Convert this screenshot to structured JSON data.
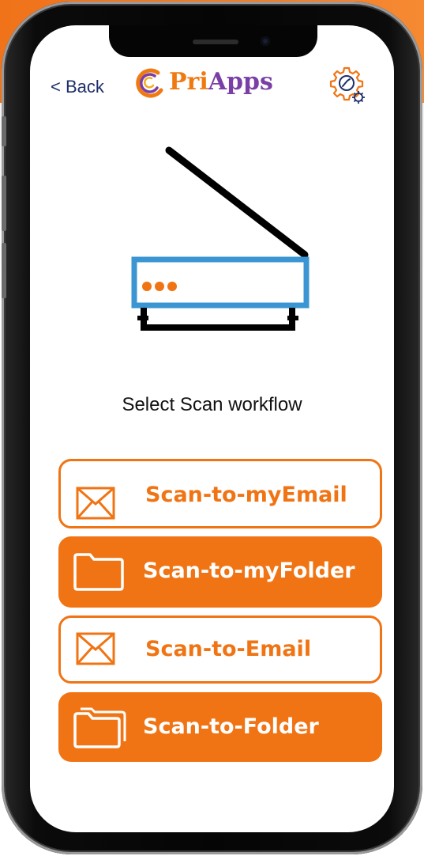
{
  "header": {
    "back_label": "< Back",
    "logo": {
      "part1": "Pri",
      "part2": "Apps"
    },
    "settings_icon": "settings-gear-icon"
  },
  "main": {
    "illustration": "scanner-icon",
    "title": "Select Scan workflow",
    "workflows": [
      {
        "label": "Scan-to-myEmail",
        "icon": "envelope-icon",
        "style": "outline"
      },
      {
        "label": "Scan-to-myFolder",
        "icon": "folder-icon",
        "style": "filled"
      },
      {
        "label": "Scan-to-Email",
        "icon": "envelope-icon",
        "style": "outline"
      },
      {
        "label": "Scan-to-Folder",
        "icon": "folders-icon",
        "style": "filled"
      }
    ]
  },
  "colors": {
    "accent": "#f07414",
    "back_link": "#1e2f6b",
    "scanner_blue": "#3a95d2",
    "logo_purple": "#7a3fa6"
  }
}
